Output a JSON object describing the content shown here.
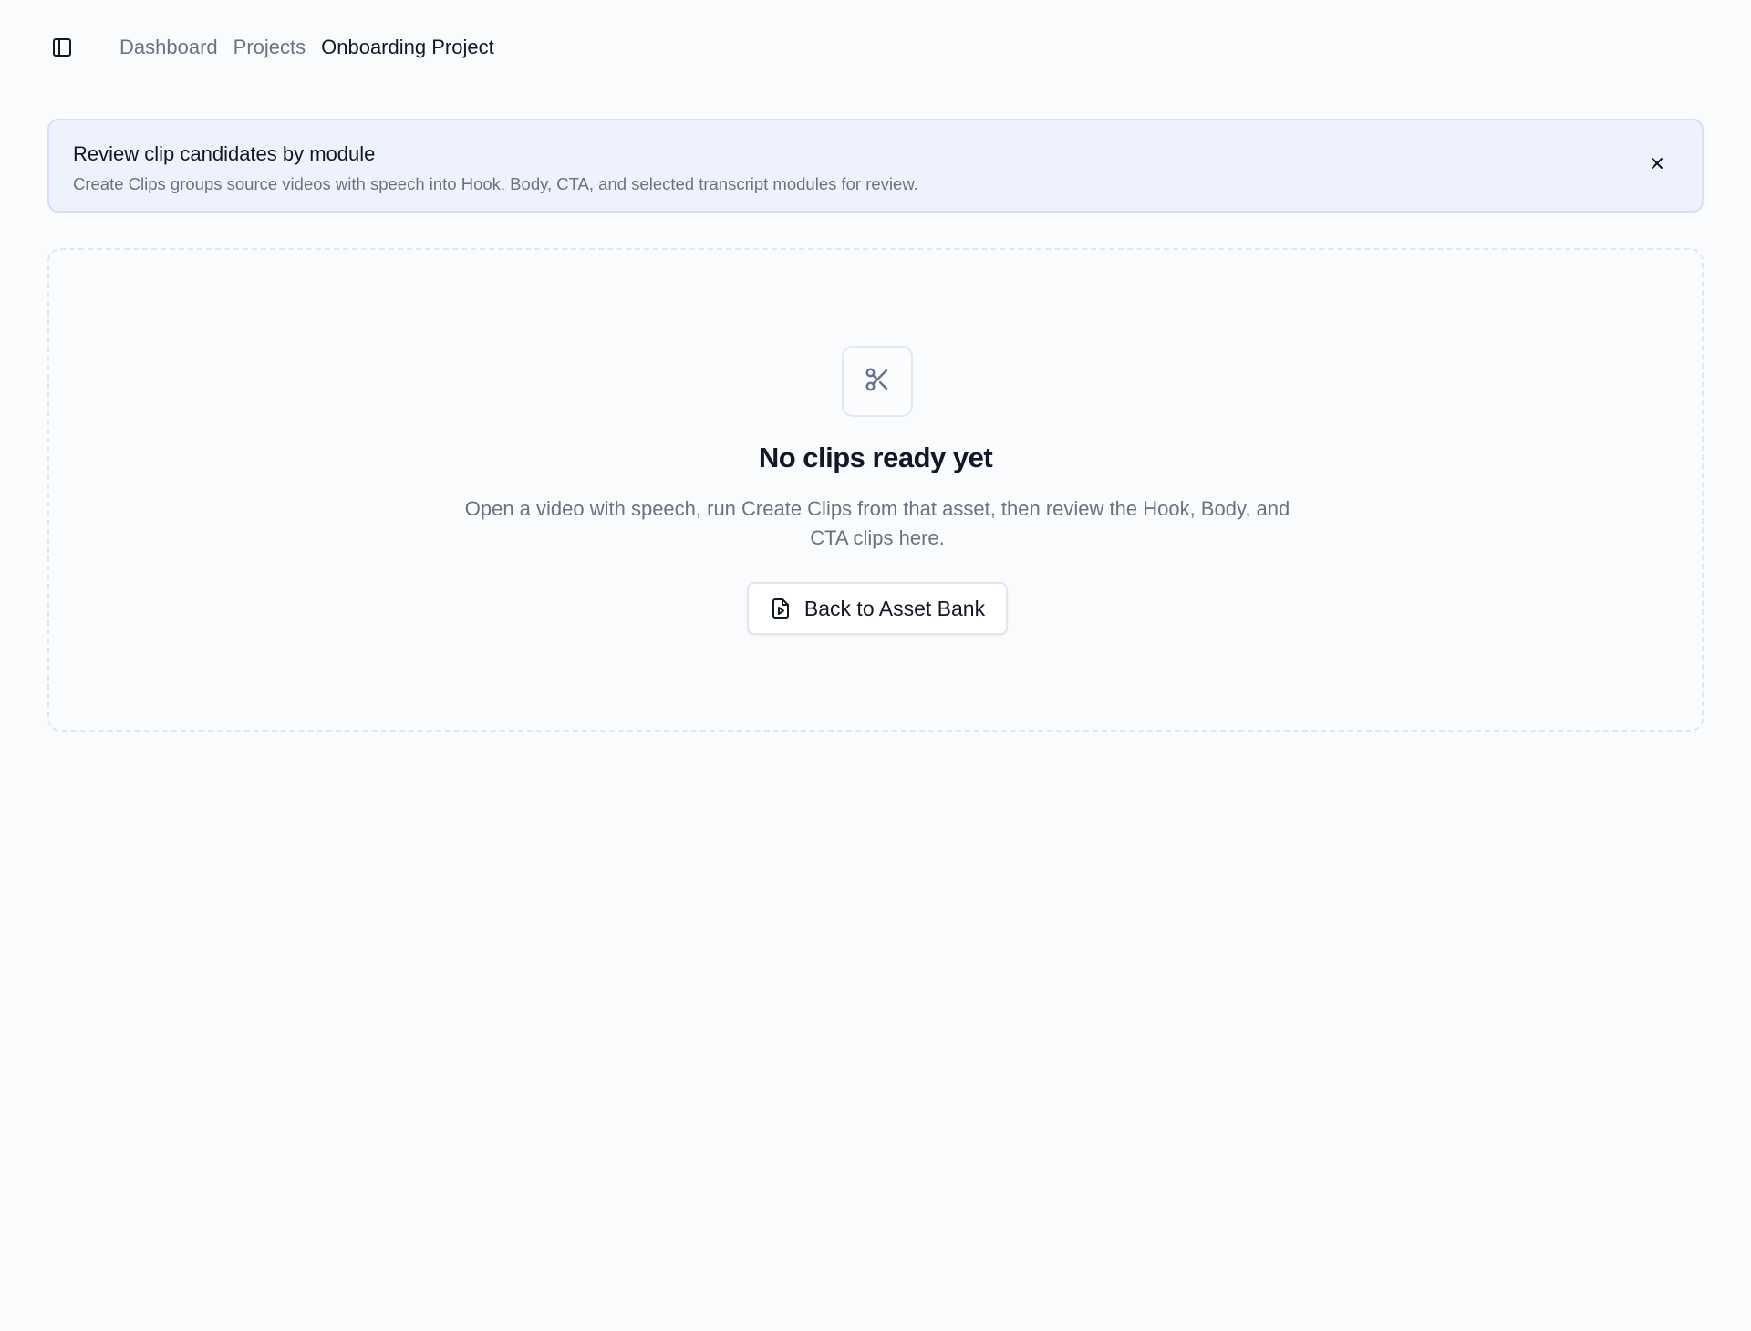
{
  "header": {
    "sidebar_toggle_icon": "panel-left-icon",
    "breadcrumb": [
      {
        "label": "Dashboard"
      },
      {
        "label": "Projects"
      },
      {
        "label": "Onboarding Project"
      }
    ]
  },
  "banner": {
    "title": "Review clip candidates by module",
    "description": "Create Clips groups source videos with speech into Hook, Body, CTA, and selected transcript modules for review.",
    "close_icon": "close-icon",
    "background_color": "#eef2fc",
    "border_color": "#d8def5"
  },
  "empty_state": {
    "icon": "scissors-icon",
    "title": "No clips ready yet",
    "description": "Open a video with speech, run Create Clips from that asset, then review the Hook, Body, and CTA clips here.",
    "button": {
      "label": "Back to Asset Bank",
      "icon": "file-video-icon"
    }
  },
  "colors": {
    "page_background": "#f9fbfd",
    "text_primary": "#111827",
    "text_muted": "#6b7280"
  }
}
